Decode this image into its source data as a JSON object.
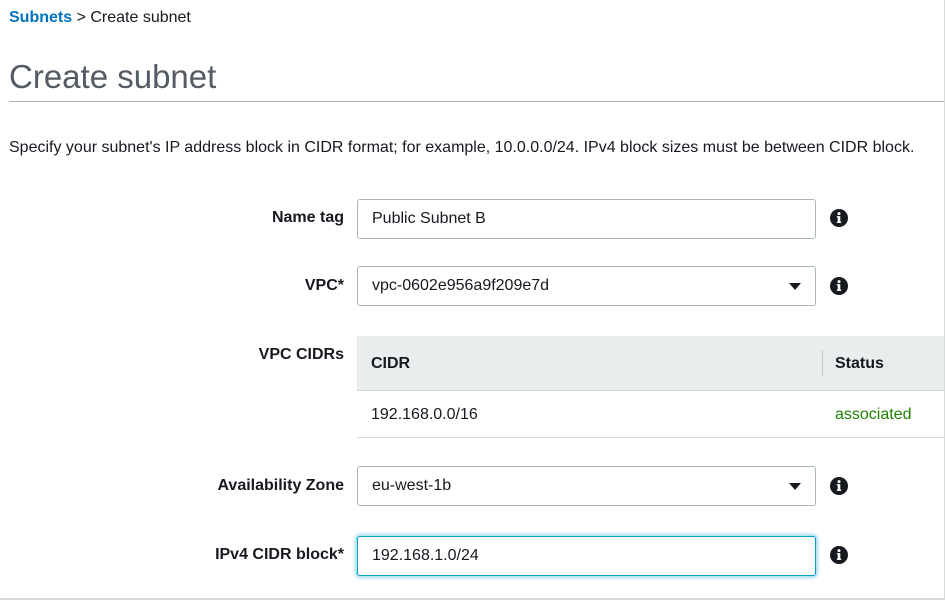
{
  "breadcrumb": {
    "link": "Subnets",
    "separator": " > ",
    "current": "Create subnet"
  },
  "page": {
    "title": "Create subnet",
    "description": "Specify your subnet's IP address block in CIDR format; for example, 10.0.0.0/24. IPv4 block sizes must be between CIDR block."
  },
  "form": {
    "name_tag": {
      "label": "Name tag",
      "value": "Public Subnet B"
    },
    "vpc": {
      "label": "VPC*",
      "value": "vpc-0602e956a9f209e7d"
    },
    "vpc_cidrs": {
      "label": "VPC CIDRs",
      "columns": [
        "CIDR",
        "Status"
      ],
      "rows": [
        {
          "cidr": "192.168.0.0/16",
          "status": "associated"
        }
      ]
    },
    "availability_zone": {
      "label": "Availability Zone",
      "value": "eu-west-1b"
    },
    "ipv4_cidr": {
      "label": "IPv4 CIDR block*",
      "value": "192.168.1.0/24"
    }
  },
  "colors": {
    "link": "#0073bb",
    "status_associated": "#1d8102",
    "focus": "#00a1c9"
  },
  "icons": {
    "info": "info-icon",
    "dropdown": "chevron-down-icon"
  }
}
